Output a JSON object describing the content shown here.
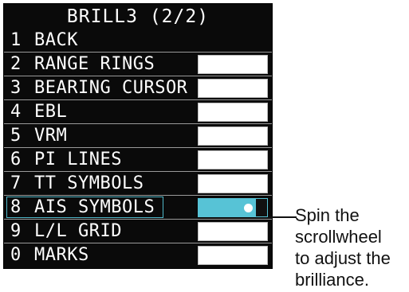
{
  "menu": {
    "title": "BRILL3 (2/2)",
    "items": [
      {
        "num": "1",
        "label": "BACK"
      },
      {
        "num": "2",
        "label": "RANGE RINGS"
      },
      {
        "num": "3",
        "label": "BEARING CURSOR"
      },
      {
        "num": "4",
        "label": "EBL"
      },
      {
        "num": "5",
        "label": "VRM"
      },
      {
        "num": "6",
        "label": "PI LINES"
      },
      {
        "num": "7",
        "label": "TT SYMBOLS"
      },
      {
        "num": "8",
        "label": "AIS SYMBOLS"
      },
      {
        "num": "9",
        "label": "L/L GRID"
      },
      {
        "num": "0",
        "label": "MARKS"
      }
    ],
    "selected_item": "8",
    "selected_brilliance_fraction": 0.7
  },
  "callout": {
    "lines": [
      "Spin the",
      "scrollwheel",
      "to adjust the",
      "brilliance."
    ]
  },
  "colors": {
    "menu_bg": "#0a0a0a",
    "text": "#ffffff",
    "selected_bar": "#57c3d6",
    "selected_outline": "#4fb7c8"
  }
}
